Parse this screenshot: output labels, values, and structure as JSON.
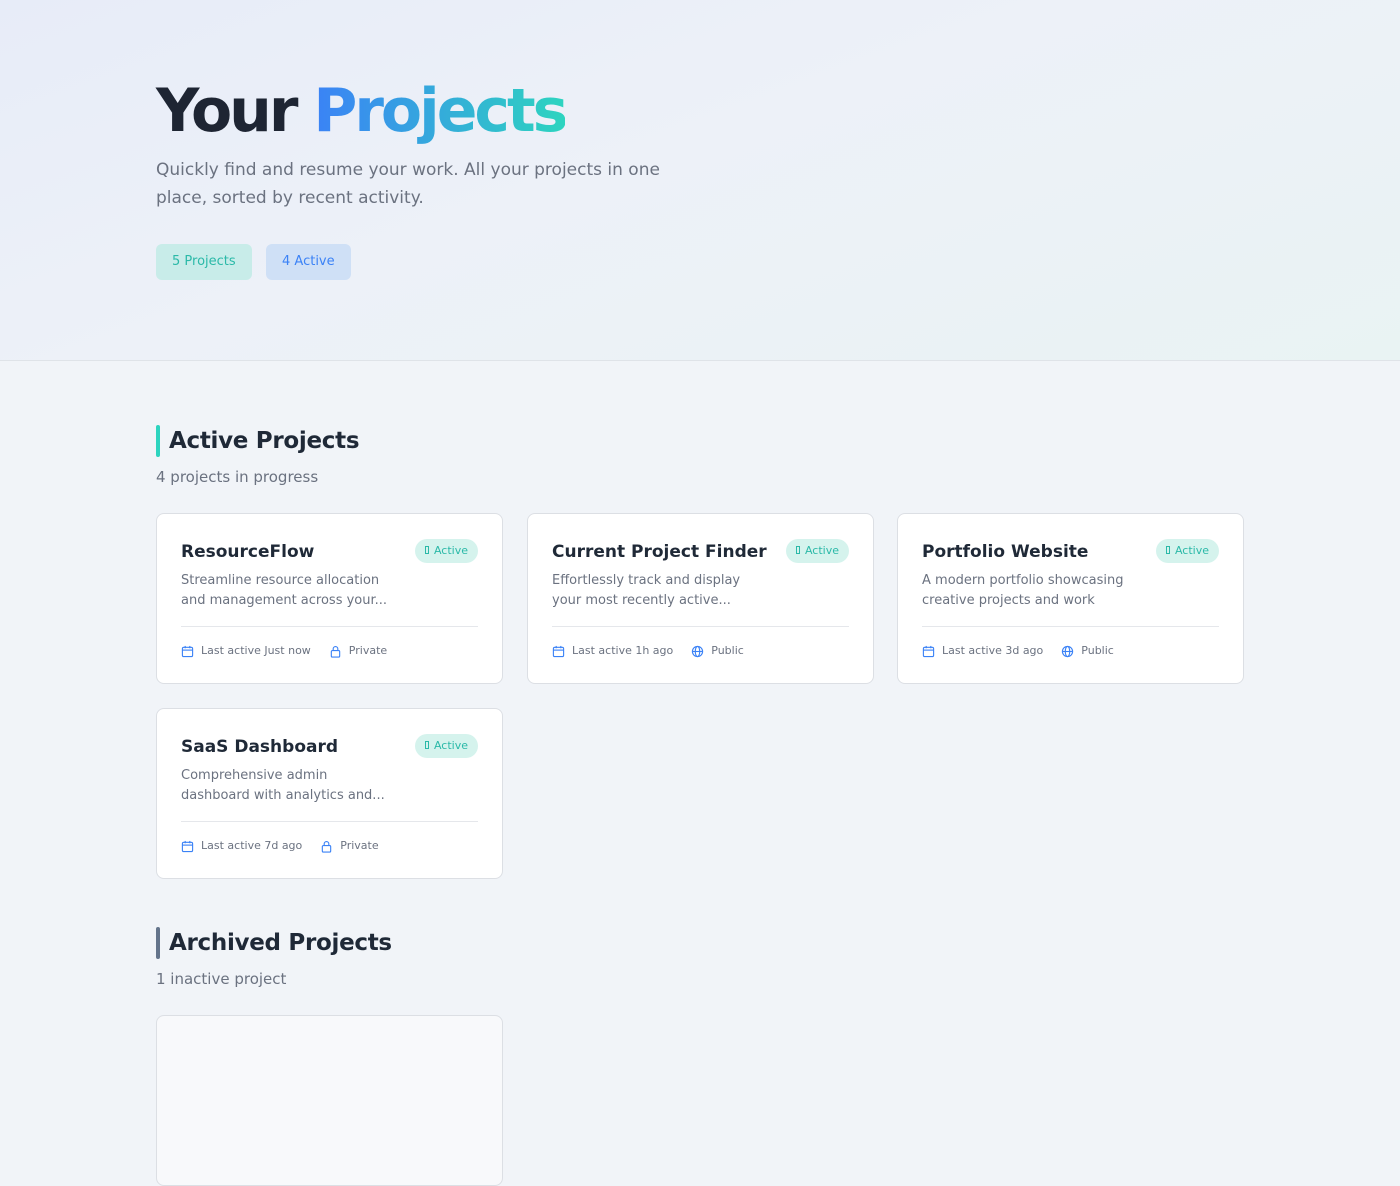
{
  "header": {
    "title_plain": "Your",
    "title_accent": "Projects",
    "subtitle": "Quickly find and resume your work. All your projects in one place, sorted by recent activity.",
    "pill_projects": "5 Projects",
    "pill_active": "4 Active"
  },
  "active_section": {
    "title": "Active Projects",
    "subtitle": "4 projects in progress",
    "accent_color": "#2dd4bf",
    "cards": [
      {
        "title": "ResourceFlow",
        "badge": "Active",
        "description": "Streamline resource allocation and management across your...",
        "last_active": "Last active Just now",
        "visibility": "Private",
        "visibility_icon": "lock-icon"
      },
      {
        "title": "Current Project Finder",
        "badge": "Active",
        "description": "Effortlessly track and display your most recently active...",
        "last_active": "Last active 1h ago",
        "visibility": "Public",
        "visibility_icon": "globe-icon"
      },
      {
        "title": "Portfolio Website",
        "badge": "Active",
        "description": "A modern portfolio showcasing creative projects and work",
        "last_active": "Last active 3d ago",
        "visibility": "Public",
        "visibility_icon": "globe-icon"
      },
      {
        "title": "SaaS Dashboard",
        "badge": "Active",
        "description": "Comprehensive admin dashboard with analytics and...",
        "last_active": "Last active 7d ago",
        "visibility": "Private",
        "visibility_icon": "lock-icon"
      }
    ]
  },
  "archived_section": {
    "title": "Archived Projects",
    "subtitle": "1 inactive project",
    "accent_color": "#64748b"
  },
  "colors": {
    "accent_blue": "#3b82f6",
    "accent_teal": "#2dd4bf",
    "badge_bg": "#d5f3ed",
    "icon_blue": "#3b82f6"
  }
}
